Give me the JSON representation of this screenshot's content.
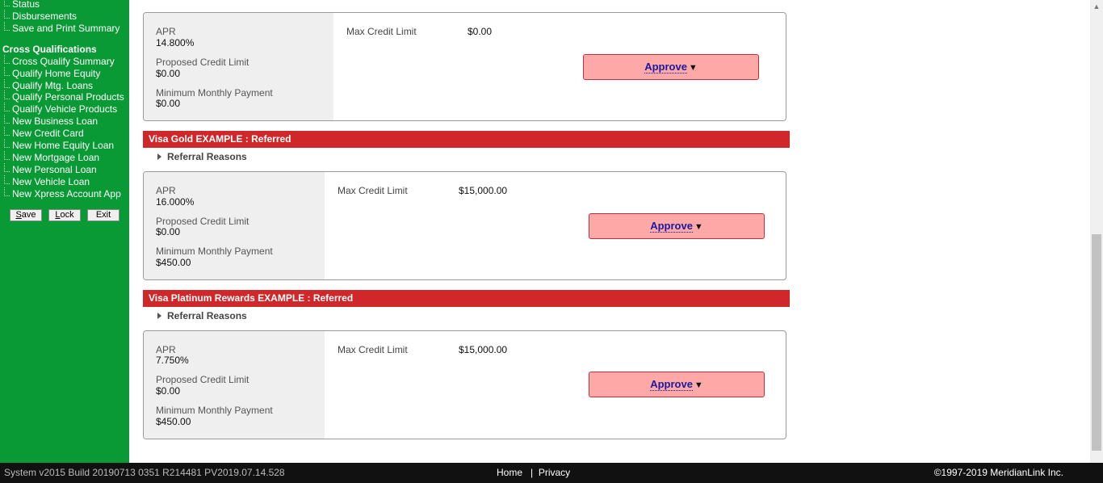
{
  "sidebar": {
    "top_items": [
      "Status",
      "Disbursements",
      "Save and Print Summary"
    ],
    "section_title": "Cross Qualifications",
    "items": [
      "Cross Qualify Summary",
      "Qualify Home Equity",
      "Qualify Mtg. Loans",
      "Qualify Personal Products",
      "Qualify Vehicle Products",
      "New Business Loan",
      "New Credit Card",
      "New Home Equity Loan",
      "New Mortgage Loan",
      "New Personal Loan",
      "New Vehicle Loan",
      "New Xpress Account App"
    ],
    "buttons": {
      "save": "ave",
      "save_key": "S",
      "lock": "ock",
      "lock_key": "L",
      "exit": "Exit"
    }
  },
  "products": [
    {
      "banner": "",
      "referral_reasons": "",
      "apr_label": "APR",
      "apr": "14.800%",
      "pcl_label": "Proposed Credit Limit",
      "pcl": "$0.00",
      "mmp_label": "Minimum Monthly Payment",
      "mmp": "$0.00",
      "mcl_label": "Max Credit Limit",
      "mcl": "$0.00",
      "approve": "Approve"
    },
    {
      "banner": "Visa Gold EXAMPLE : Referred",
      "referral_reasons": "Referral Reasons",
      "apr_label": "APR",
      "apr": "16.000%",
      "pcl_label": "Proposed Credit Limit",
      "pcl": "$0.00",
      "mmp_label": "Minimum Monthly Payment",
      "mmp": "$450.00",
      "mcl_label": "Max Credit Limit",
      "mcl": "$15,000.00",
      "approve": "Approve"
    },
    {
      "banner": "Visa Platinum Rewards EXAMPLE : Referred",
      "referral_reasons": "Referral Reasons",
      "apr_label": "APR",
      "apr": "7.750%",
      "pcl_label": "Proposed Credit Limit",
      "pcl": "$0.00",
      "mmp_label": "Minimum Monthly Payment",
      "mmp": "$450.00",
      "mcl_label": "Max Credit Limit",
      "mcl": "$15,000.00",
      "approve": "Approve"
    }
  ],
  "footer": {
    "build": "System v2015 Build 20190713 0351 R214481 PV2019.07.14.528",
    "home": "Home",
    "separator": "|",
    "privacy": "Privacy",
    "copyright": "©1997-2019 MeridianLink Inc."
  },
  "colors": {
    "sidebar": "#0a9a35",
    "banner": "#d0282a",
    "approve_bg": "#ffa8a8",
    "footer": "#111111"
  }
}
